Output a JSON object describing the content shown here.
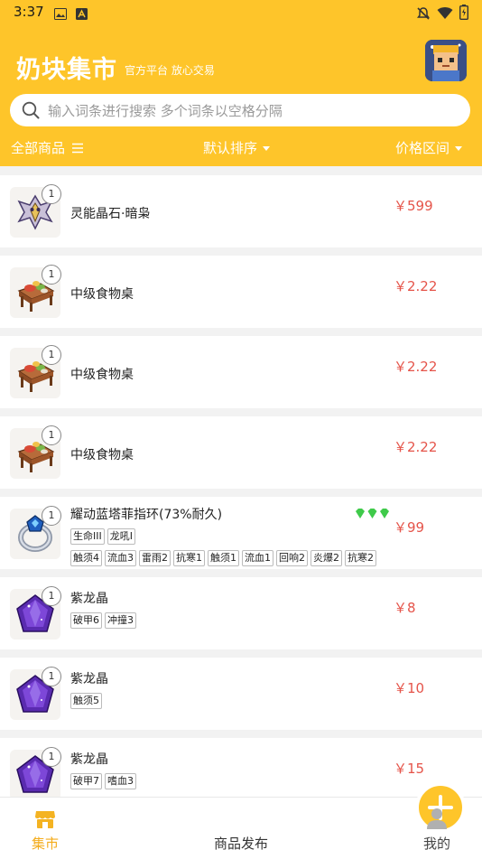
{
  "status": {
    "time": "3:37"
  },
  "header": {
    "title": "奶块集市",
    "subtitle": "官方平台 放心交易"
  },
  "search": {
    "placeholder": "输入词条进行搜索 多个词条以空格分隔"
  },
  "filters": {
    "all": "全部商品",
    "sort": "默认排序",
    "price_range": "价格区间"
  },
  "items": [
    {
      "name": "灵能晶石·暗枭",
      "price": "￥599",
      "qty": "1",
      "icon": "crystal-owl-icon",
      "tags": [],
      "tags2": []
    },
    {
      "name": "中级食物桌",
      "price": "￥2.22",
      "qty": "1",
      "icon": "food-table-icon",
      "tags": [],
      "tags2": []
    },
    {
      "name": "中级食物桌",
      "price": "￥2.22",
      "qty": "1",
      "icon": "food-table-icon",
      "tags": [],
      "tags2": []
    },
    {
      "name": "中级食物桌",
      "price": "￥2.22",
      "qty": "1",
      "icon": "food-table-icon",
      "tags": [],
      "tags2": []
    },
    {
      "name": "耀动蓝塔菲指环(73%耐久)",
      "price": "￥99",
      "qty": "1",
      "icon": "blue-ring-icon",
      "tags": [
        "生命III",
        "龙吼I"
      ],
      "tags2": [
        "触须4",
        "流血3",
        "雷雨2",
        "抗寒1",
        "触须1",
        "流血1",
        "回响2",
        "炎爆2",
        "抗寒2"
      ]
    },
    {
      "name": "紫龙晶",
      "price": "￥8",
      "qty": "1",
      "icon": "purple-crystal-icon",
      "tags": [
        "破甲6",
        "冲撞3"
      ],
      "tags2": []
    },
    {
      "name": "紫龙晶",
      "price": "￥10",
      "qty": "1",
      "icon": "purple-crystal-icon",
      "tags": [
        "触须5"
      ],
      "tags2": []
    },
    {
      "name": "紫龙晶",
      "price": "￥15",
      "qty": "1",
      "icon": "purple-crystal-icon",
      "tags": [
        "破甲7",
        "嗜血3"
      ],
      "tags2": []
    }
  ],
  "tabbar": {
    "market": "集市",
    "publish": "商品发布",
    "mine": "我的"
  },
  "colors": {
    "brand": "#fec52a",
    "price": "#e5544a",
    "background": "#f2f2f2"
  }
}
